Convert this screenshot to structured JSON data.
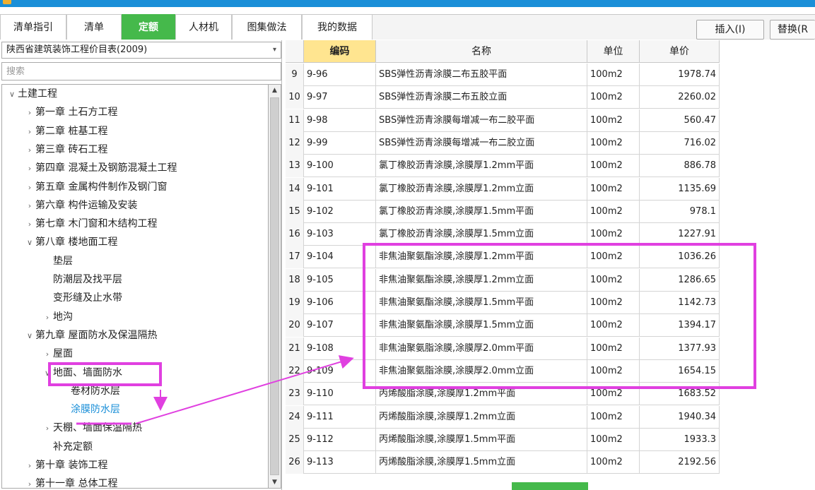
{
  "tabs": [
    {
      "label": "清单指引",
      "active": false
    },
    {
      "label": "清单",
      "active": false
    },
    {
      "label": "定额",
      "active": true
    },
    {
      "label": "人材机",
      "active": false
    },
    {
      "label": "图集做法",
      "active": false
    },
    {
      "label": "我的数据",
      "active": false
    }
  ],
  "toolbar": {
    "insert_label": "插入(I)",
    "replace_label": "替换(R"
  },
  "library": {
    "selected": "陕西省建筑装饰工程价目表(2009)"
  },
  "search": {
    "placeholder": "搜索"
  },
  "tree": [
    {
      "label": "土建工程",
      "indent": 0,
      "arrow": "down"
    },
    {
      "label": "第一章 土石方工程",
      "indent": 1,
      "arrow": "right"
    },
    {
      "label": "第二章 桩基工程",
      "indent": 1,
      "arrow": "right"
    },
    {
      "label": "第三章 砖石工程",
      "indent": 1,
      "arrow": "right"
    },
    {
      "label": "第四章 混凝土及钢筋混凝土工程",
      "indent": 1,
      "arrow": "right"
    },
    {
      "label": "第五章 金属构件制作及钢门窗",
      "indent": 1,
      "arrow": "right"
    },
    {
      "label": "第六章 构件运输及安装",
      "indent": 1,
      "arrow": "right"
    },
    {
      "label": "第七章 木门窗和木结构工程",
      "indent": 1,
      "arrow": "right"
    },
    {
      "label": "第八章 楼地面工程",
      "indent": 1,
      "arrow": "down"
    },
    {
      "label": "垫层",
      "indent": 2,
      "arrow": ""
    },
    {
      "label": "防潮层及找平层",
      "indent": 2,
      "arrow": ""
    },
    {
      "label": "变形缝及止水带",
      "indent": 2,
      "arrow": ""
    },
    {
      "label": "地沟",
      "indent": 2,
      "arrow": "right"
    },
    {
      "label": "第九章 屋面防水及保温隔热",
      "indent": 1,
      "arrow": "down"
    },
    {
      "label": "屋面",
      "indent": 2,
      "arrow": "right"
    },
    {
      "label": "地面、墙面防水",
      "indent": 2,
      "arrow": "down"
    },
    {
      "label": "卷材防水层",
      "indent": 3,
      "arrow": ""
    },
    {
      "label": "涂膜防水层",
      "indent": 3,
      "arrow": "",
      "selected": true
    },
    {
      "label": "天棚、墙面保温隔热",
      "indent": 2,
      "arrow": "right"
    },
    {
      "label": "补充定额",
      "indent": 2,
      "arrow": ""
    },
    {
      "label": "第十章 装饰工程",
      "indent": 1,
      "arrow": "right"
    },
    {
      "label": "第十一章 总体工程",
      "indent": 1,
      "arrow": "right"
    }
  ],
  "grid": {
    "headers": [
      "",
      "编码",
      "名称",
      "单位",
      "单价"
    ],
    "rows": [
      {
        "idx": "9",
        "code": "9-96",
        "name": "SBS弹性沥青涂膜二布五胶平面",
        "unit": "100m2",
        "price": "1978.74"
      },
      {
        "idx": "10",
        "code": "9-97",
        "name": "SBS弹性沥青涂膜二布五胶立面",
        "unit": "100m2",
        "price": "2260.02"
      },
      {
        "idx": "11",
        "code": "9-98",
        "name": "SBS弹性沥青涂膜每增减一布二胶平面",
        "unit": "100m2",
        "price": "560.47"
      },
      {
        "idx": "12",
        "code": "9-99",
        "name": "SBS弹性沥青涂膜每增减一布二胶立面",
        "unit": "100m2",
        "price": "716.02"
      },
      {
        "idx": "13",
        "code": "9-100",
        "name": "氯丁橡胶沥青涂膜,涂膜厚1.2mm平面",
        "unit": "100m2",
        "price": "886.78"
      },
      {
        "idx": "14",
        "code": "9-101",
        "name": "氯丁橡胶沥青涂膜,涂膜厚1.2mm立面",
        "unit": "100m2",
        "price": "1135.69"
      },
      {
        "idx": "15",
        "code": "9-102",
        "name": "氯丁橡胶沥青涂膜,涂膜厚1.5mm平面",
        "unit": "100m2",
        "price": "978.1"
      },
      {
        "idx": "16",
        "code": "9-103",
        "name": "氯丁橡胶沥青涂膜,涂膜厚1.5mm立面",
        "unit": "100m2",
        "price": "1227.91"
      },
      {
        "idx": "17",
        "code": "9-104",
        "name": "非焦油聚氨酯涂膜,涂膜厚1.2mm平面",
        "unit": "100m2",
        "price": "1036.26"
      },
      {
        "idx": "18",
        "code": "9-105",
        "name": "非焦油聚氨酯涂膜,涂膜厚1.2mm立面",
        "unit": "100m2",
        "price": "1286.65"
      },
      {
        "idx": "19",
        "code": "9-106",
        "name": "非焦油聚氨酯涂膜,涂膜厚1.5mm平面",
        "unit": "100m2",
        "price": "1142.73"
      },
      {
        "idx": "20",
        "code": "9-107",
        "name": "非焦油聚氨酯涂膜,涂膜厚1.5mm立面",
        "unit": "100m2",
        "price": "1394.17"
      },
      {
        "idx": "21",
        "code": "9-108",
        "name": "非焦油聚氨脂涂膜,涂膜厚2.0mm平面",
        "unit": "100m2",
        "price": "1377.93"
      },
      {
        "idx": "22",
        "code": "9-109",
        "name": "非焦油聚氨脂涂膜,涂膜厚2.0mm立面",
        "unit": "100m2",
        "price": "1654.15"
      },
      {
        "idx": "23",
        "code": "9-110",
        "name": "丙烯酸脂涂膜,涂膜厚1.2mm平面",
        "unit": "100m2",
        "price": "1683.52"
      },
      {
        "idx": "24",
        "code": "9-111",
        "name": "丙烯酸脂涂膜,涂膜厚1.2mm立面",
        "unit": "100m2",
        "price": "1940.34"
      },
      {
        "idx": "25",
        "code": "9-112",
        "name": "丙烯酸脂涂膜,涂膜厚1.5mm平面",
        "unit": "100m2",
        "price": "1933.3"
      },
      {
        "idx": "26",
        "code": "9-113",
        "name": "丙烯酸脂涂膜,涂膜厚1.5mm立面",
        "unit": "100m2",
        "price": "2192.56"
      }
    ]
  },
  "colors": {
    "accent_green": "#45b94b",
    "title_blue": "#1a8fd8",
    "annotation_magenta": "#e040e0",
    "code_header": "#ffe590",
    "link_blue": "#1a8fd8"
  }
}
